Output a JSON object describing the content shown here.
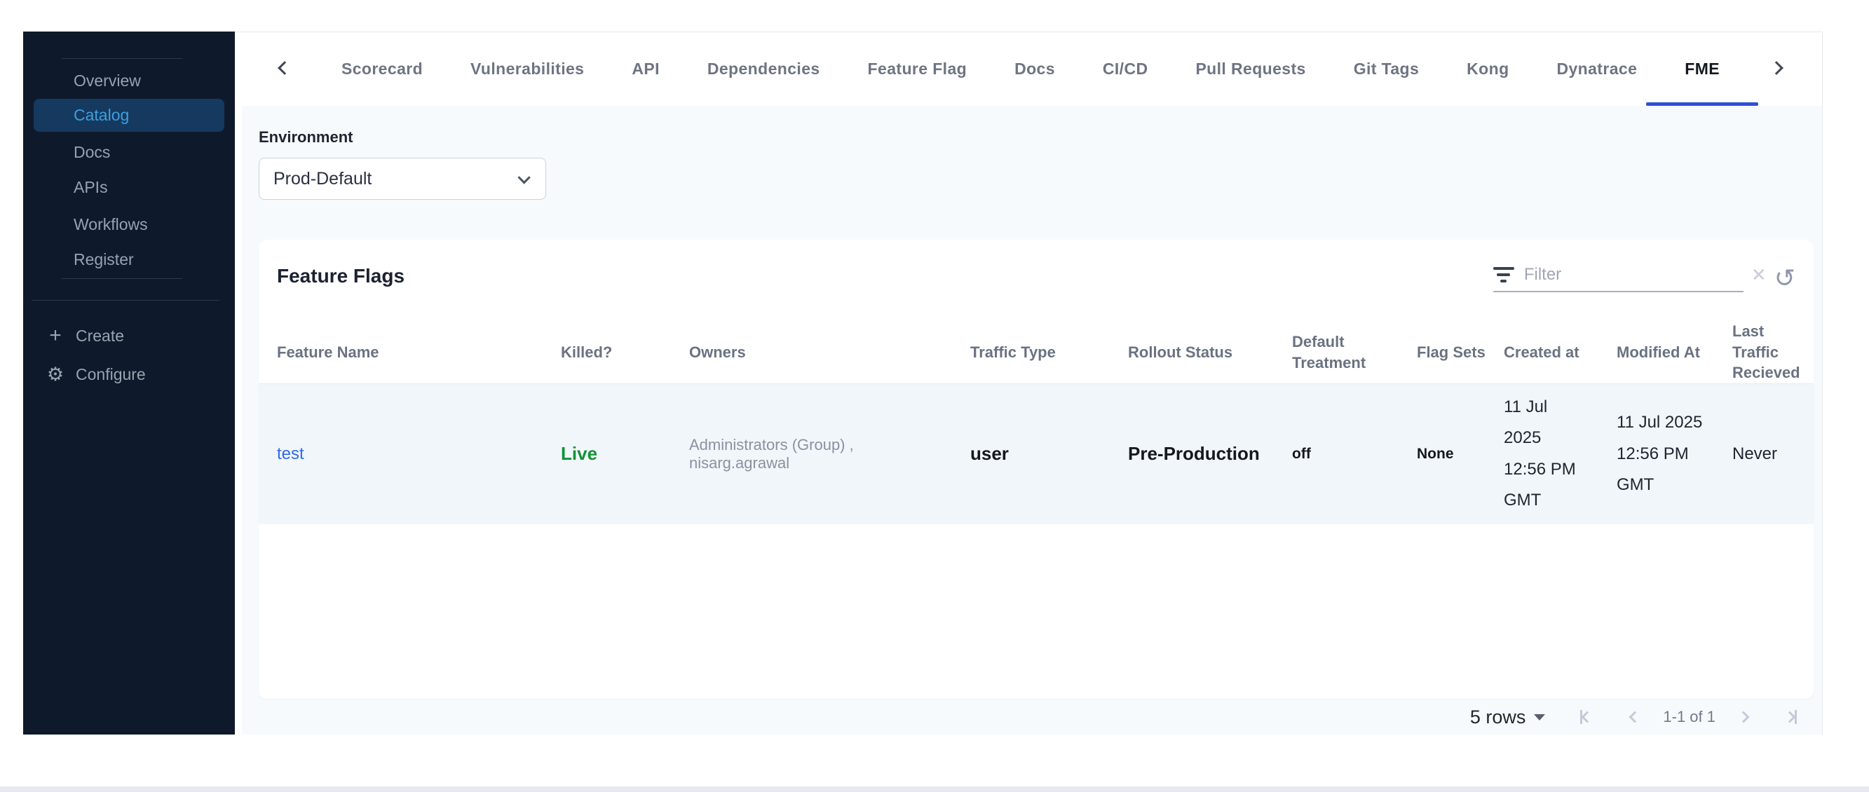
{
  "sidebar": {
    "items": [
      "Overview",
      "Catalog",
      "Docs",
      "APIs",
      "Workflows",
      "Register"
    ],
    "active": "Catalog",
    "create": "Create",
    "configure": "Configure"
  },
  "tabs": {
    "items": [
      "Scorecard",
      "Vulnerabilities",
      "API",
      "Dependencies",
      "Feature Flag",
      "Docs",
      "CI/CD",
      "Pull Requests",
      "Git Tags",
      "Kong",
      "Dynatrace",
      "FME"
    ],
    "active": "FME"
  },
  "environment": {
    "label": "Environment",
    "selected": "Prod-Default"
  },
  "feature_flags": {
    "title": "Feature Flags",
    "filter_placeholder": "Filter",
    "columns": [
      "Feature Name",
      "Killed?",
      "Owners",
      "Traffic Type",
      "Rollout Status",
      "Default Treatment",
      "Flag Sets",
      "Created at",
      "Modified At",
      "Last Traffic Recieved"
    ],
    "rows": [
      {
        "feature_name": "test",
        "killed": "Live",
        "owners": "Administrators (Group) , nisarg.agrawal",
        "traffic_type": "user",
        "rollout_status": "Pre-Production",
        "default_treatment": "off",
        "flag_sets": "None",
        "created_at": "11 Jul\n2025\n12:56 PM\nGMT",
        "modified_at": "11 Jul 2025\n12:56 PM\nGMT",
        "last_traffic_recieved": "Never"
      }
    ]
  },
  "pagination": {
    "rows_per_page": "5 rows",
    "range": "1-1 of 1"
  },
  "colors": {
    "sidebar_bg": "#0e1a2b",
    "sidebar_active_bg": "#16395f",
    "sidebar_active_text": "#3ba0dd",
    "tab_underline": "#2c51d8",
    "link_blue": "#2e6be6",
    "live_green": "#149237",
    "row_bg": "#f1f6fb",
    "content_bg": "#f7fafd"
  }
}
